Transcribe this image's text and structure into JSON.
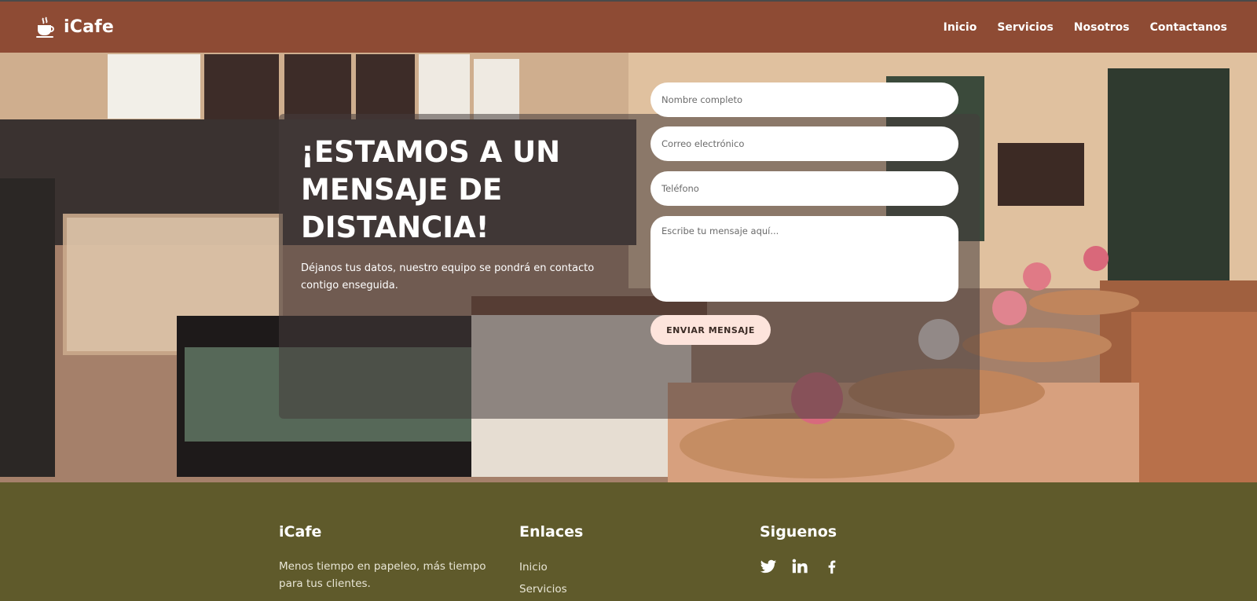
{
  "brand": {
    "name": "iCafe",
    "icon": "coffee-cup-icon"
  },
  "nav": {
    "links": [
      "Inicio",
      "Servicios",
      "Nosotros",
      "Contactanos"
    ]
  },
  "hero": {
    "headline": "¡ESTAMOS A UN MENSAJE DE DISTANCIA!",
    "subtext": "Déjanos tus datos, nuestro equipo se pondrá en contacto contigo enseguida."
  },
  "form": {
    "name_placeholder": "Nombre completo",
    "email_placeholder": "Correo electrónico",
    "phone_placeholder": "Teléfono",
    "message_placeholder": "Escribe tu mensaje aquí...",
    "submit_label": "ENVIAR MENSAJE"
  },
  "footer": {
    "col1": {
      "title": "iCafe",
      "description": "Menos tiempo en papeleo, más tiempo para tus clientes."
    },
    "col2": {
      "title": "Enlaces",
      "links": [
        "Inicio",
        "Servicios"
      ]
    },
    "col3": {
      "title": "Siguenos",
      "socials": [
        "twitter-icon",
        "linkedin-icon",
        "facebook-icon"
      ]
    }
  },
  "colors": {
    "navbar": "#8e4b34",
    "footer": "#5f5a2b",
    "button": "#fde4dc"
  }
}
